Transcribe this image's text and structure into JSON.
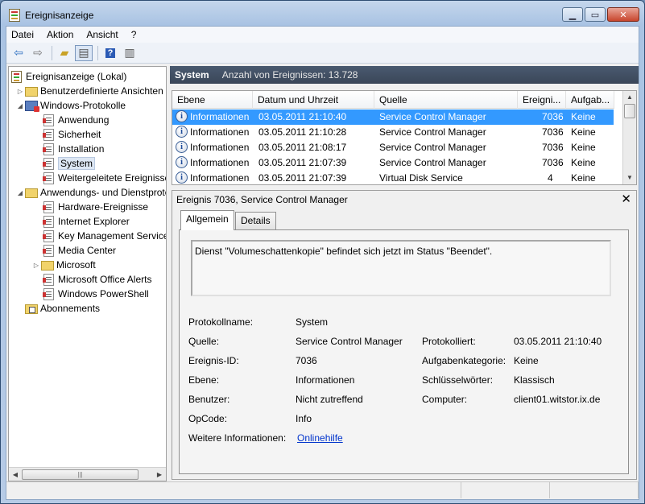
{
  "window": {
    "title": "Ereignisanzeige",
    "minimize": "▁",
    "maximize": "▭",
    "close": "✕"
  },
  "menu": [
    "Datei",
    "Aktion",
    "Ansicht",
    "?"
  ],
  "tree": {
    "items": [
      {
        "label": "Ereignisanzeige (Lokal)",
        "icon": "event-viewer-icon"
      },
      {
        "label": "Benutzerdefinierte Ansichten",
        "icon": "folder-icon"
      },
      {
        "label": "Windows-Protokolle",
        "icon": "windows-logs-folder-icon"
      },
      {
        "label": "Anwendung",
        "icon": "log-icon"
      },
      {
        "label": "Sicherheit",
        "icon": "log-icon"
      },
      {
        "label": "Installation",
        "icon": "log-icon"
      },
      {
        "label": "System",
        "icon": "log-icon"
      },
      {
        "label": "Weitergeleitete Ereignisse",
        "icon": "log-icon"
      },
      {
        "label": "Anwendungs- und Dienstprotokolle",
        "icon": "folder-icon"
      },
      {
        "label": "Hardware-Ereignisse",
        "icon": "log-icon"
      },
      {
        "label": "Internet Explorer",
        "icon": "log-icon"
      },
      {
        "label": "Key Management Service",
        "icon": "log-icon"
      },
      {
        "label": "Media Center",
        "icon": "log-icon"
      },
      {
        "label": "Microsoft",
        "icon": "folder-icon"
      },
      {
        "label": "Microsoft Office Alerts",
        "icon": "log-icon"
      },
      {
        "label": "Windows PowerShell",
        "icon": "log-icon"
      },
      {
        "label": "Abonnements",
        "icon": "subscriptions-icon"
      }
    ],
    "selected": "System"
  },
  "log_header": {
    "title": "System",
    "count": "Anzahl von Ereignissen: 13.728"
  },
  "events": {
    "columns": [
      "Ebene",
      "Datum und Uhrzeit",
      "Quelle",
      "Ereigni...",
      "Aufgab..."
    ],
    "rows": [
      {
        "level": "Informationen",
        "datetime": "03.05.2011 21:10:40",
        "source": "Service Control Manager",
        "id": "7036",
        "task": "Keine"
      },
      {
        "level": "Informationen",
        "datetime": "03.05.2011 21:10:28",
        "source": "Service Control Manager",
        "id": "7036",
        "task": "Keine"
      },
      {
        "level": "Informationen",
        "datetime": "03.05.2011 21:08:17",
        "source": "Service Control Manager",
        "id": "7036",
        "task": "Keine"
      },
      {
        "level": "Informationen",
        "datetime": "03.05.2011 21:07:39",
        "source": "Service Control Manager",
        "id": "7036",
        "task": "Keine"
      },
      {
        "level": "Informationen",
        "datetime": "03.05.2011 21:07:39",
        "source": "Virtual Disk Service",
        "id": "4",
        "task": "Keine"
      }
    ],
    "selected_index": 0
  },
  "detail": {
    "title": "Ereignis 7036, Service Control Manager",
    "close": "✕",
    "tabs": [
      "Allgemein",
      "Details"
    ],
    "description": "Dienst \"Volumeschattenkopie\" befindet sich jetzt im Status \"Beendet\".",
    "fields": {
      "protokollname_label": "Protokollname:",
      "protokollname_value": "System",
      "quelle_label": "Quelle:",
      "quelle_value": "Service Control Manager",
      "protokolliert_label": "Protokolliert:",
      "protokolliert_value": "03.05.2011 21:10:40",
      "ereignis_id_label": "Ereignis-ID:",
      "ereignis_id_value": "7036",
      "aufgabenkategorie_label": "Aufgabenkategorie:",
      "aufgabenkategorie_value": "Keine",
      "ebene_label": "Ebene:",
      "ebene_value": "Informationen",
      "schluesselwoerter_label": "Schlüsselwörter:",
      "schluesselwoerter_value": "Klassisch",
      "benutzer_label": "Benutzer:",
      "benutzer_value": "Nicht zutreffend",
      "computer_label": "Computer:",
      "computer_value": "client01.witstor.ix.de",
      "opcode_label": "OpCode:",
      "opcode_value": "Info",
      "weitere_label": "Weitere Informationen:",
      "weitere_link": "Onlinehilfe"
    }
  },
  "colors": {
    "selection": "#3399ff",
    "header_bar": "#3a4658",
    "link": "#0033cc"
  }
}
